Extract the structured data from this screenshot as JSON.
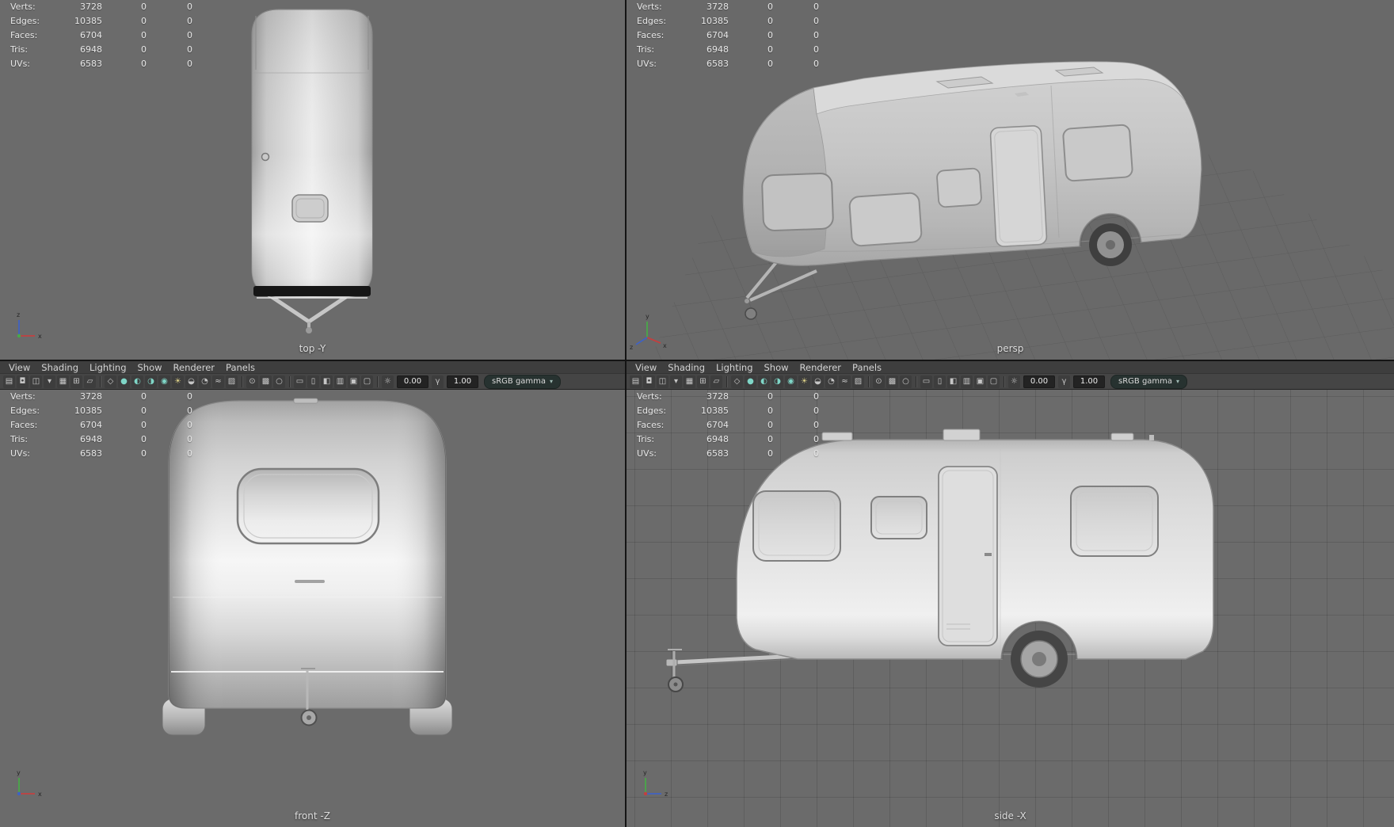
{
  "hud": {
    "rows": [
      {
        "label": "Verts:",
        "value": "3728",
        "c2": "0",
        "c3": "0"
      },
      {
        "label": "Edges:",
        "value": "10385",
        "c2": "0",
        "c3": "0"
      },
      {
        "label": "Faces:",
        "value": "6704",
        "c2": "0",
        "c3": "0"
      },
      {
        "label": "Tris:",
        "value": "6948",
        "c2": "0",
        "c3": "0"
      },
      {
        "label": "UVs:",
        "value": "6583",
        "c2": "0",
        "c3": "0"
      }
    ]
  },
  "menus": [
    "View",
    "Shading",
    "Lighting",
    "Show",
    "Renderer",
    "Panels"
  ],
  "toolbar": {
    "items": [
      {
        "name": "select-camera-icon",
        "glyph": "▤"
      },
      {
        "name": "lock-camera-icon",
        "glyph": "◘"
      },
      {
        "name": "camera-attributes-icon",
        "glyph": "◫"
      },
      {
        "name": "bookmarks-icon",
        "glyph": "▾"
      },
      {
        "name": "image-plane-icon",
        "glyph": "▦"
      },
      {
        "name": "two-d-pan-zoom-icon",
        "glyph": "⊞"
      },
      {
        "name": "grease-pencil-icon",
        "glyph": "▱"
      },
      {
        "type": "sep",
        "name": "toolbar-separator"
      },
      {
        "name": "wireframe-icon",
        "glyph": "◇"
      },
      {
        "name": "smooth-shade-icon",
        "glyph": "●",
        "color": "#7fd6c7"
      },
      {
        "name": "textured-icon",
        "glyph": "◐",
        "color": "#7fd6c7"
      },
      {
        "name": "use-default-material-icon",
        "glyph": "◑",
        "color": "#7fd6c7"
      },
      {
        "name": "wireframe-on-shaded-icon",
        "glyph": "◉",
        "color": "#7fd6c7"
      },
      {
        "name": "lighting-icon",
        "glyph": "☀",
        "color": "#d8cc85"
      },
      {
        "name": "shadows-icon",
        "glyph": "◒"
      },
      {
        "name": "screen-space-ao-icon",
        "glyph": "◔"
      },
      {
        "name": "motion-blur-icon",
        "glyph": "≈"
      },
      {
        "name": "anti-aliasing-icon",
        "glyph": "▨"
      },
      {
        "type": "sep",
        "name": "toolbar-separator"
      },
      {
        "name": "isolate-select-icon",
        "glyph": "⊙"
      },
      {
        "name": "x-ray-icon",
        "glyph": "▩"
      },
      {
        "name": "x-ray-joints-icon",
        "glyph": "○"
      },
      {
        "type": "sep",
        "name": "toolbar-separator"
      },
      {
        "name": "film-gate-icon",
        "glyph": "▭"
      },
      {
        "name": "resolution-gate-icon",
        "glyph": "▯"
      },
      {
        "name": "gate-mask-icon",
        "glyph": "◧"
      },
      {
        "name": "field-chart-icon",
        "glyph": "▥"
      },
      {
        "name": "safe-action-icon",
        "glyph": "▣"
      },
      {
        "name": "safe-title-icon",
        "glyph": "▢"
      },
      {
        "type": "sep",
        "name": "toolbar-separator"
      },
      {
        "name": "exposure-icon",
        "glyph": "☼"
      },
      {
        "type": "field",
        "name": "exposure-field",
        "value": "0.00"
      },
      {
        "name": "gamma-icon",
        "glyph": "γ"
      },
      {
        "type": "field",
        "name": "gamma-field",
        "value": "1.00"
      },
      {
        "type": "chip",
        "name": "view-transform-select",
        "value": "sRGB gamma"
      }
    ]
  },
  "viewports": {
    "top": {
      "label": "top -Y"
    },
    "persp": {
      "label": "persp"
    },
    "front": {
      "label": "front -Z"
    },
    "side": {
      "label": "side -X"
    }
  },
  "axes": {
    "x": "x",
    "y": "y",
    "z": "z"
  },
  "colors": {
    "viewport_bg": "#6b6b6b",
    "persp_bg": "#696969",
    "header_bg": "#3e3e3e",
    "toolbar_bg": "#454545",
    "hud_text": "#e7e7e7",
    "label_text": "#dedede",
    "grid_line": "#5e5e5e",
    "divider": "#141414",
    "accent_teal": "#7fd6c7",
    "axis_x": "#c24040",
    "axis_y": "#49a849",
    "axis_z": "#4062c2",
    "model_body": "#d6d6d6"
  }
}
